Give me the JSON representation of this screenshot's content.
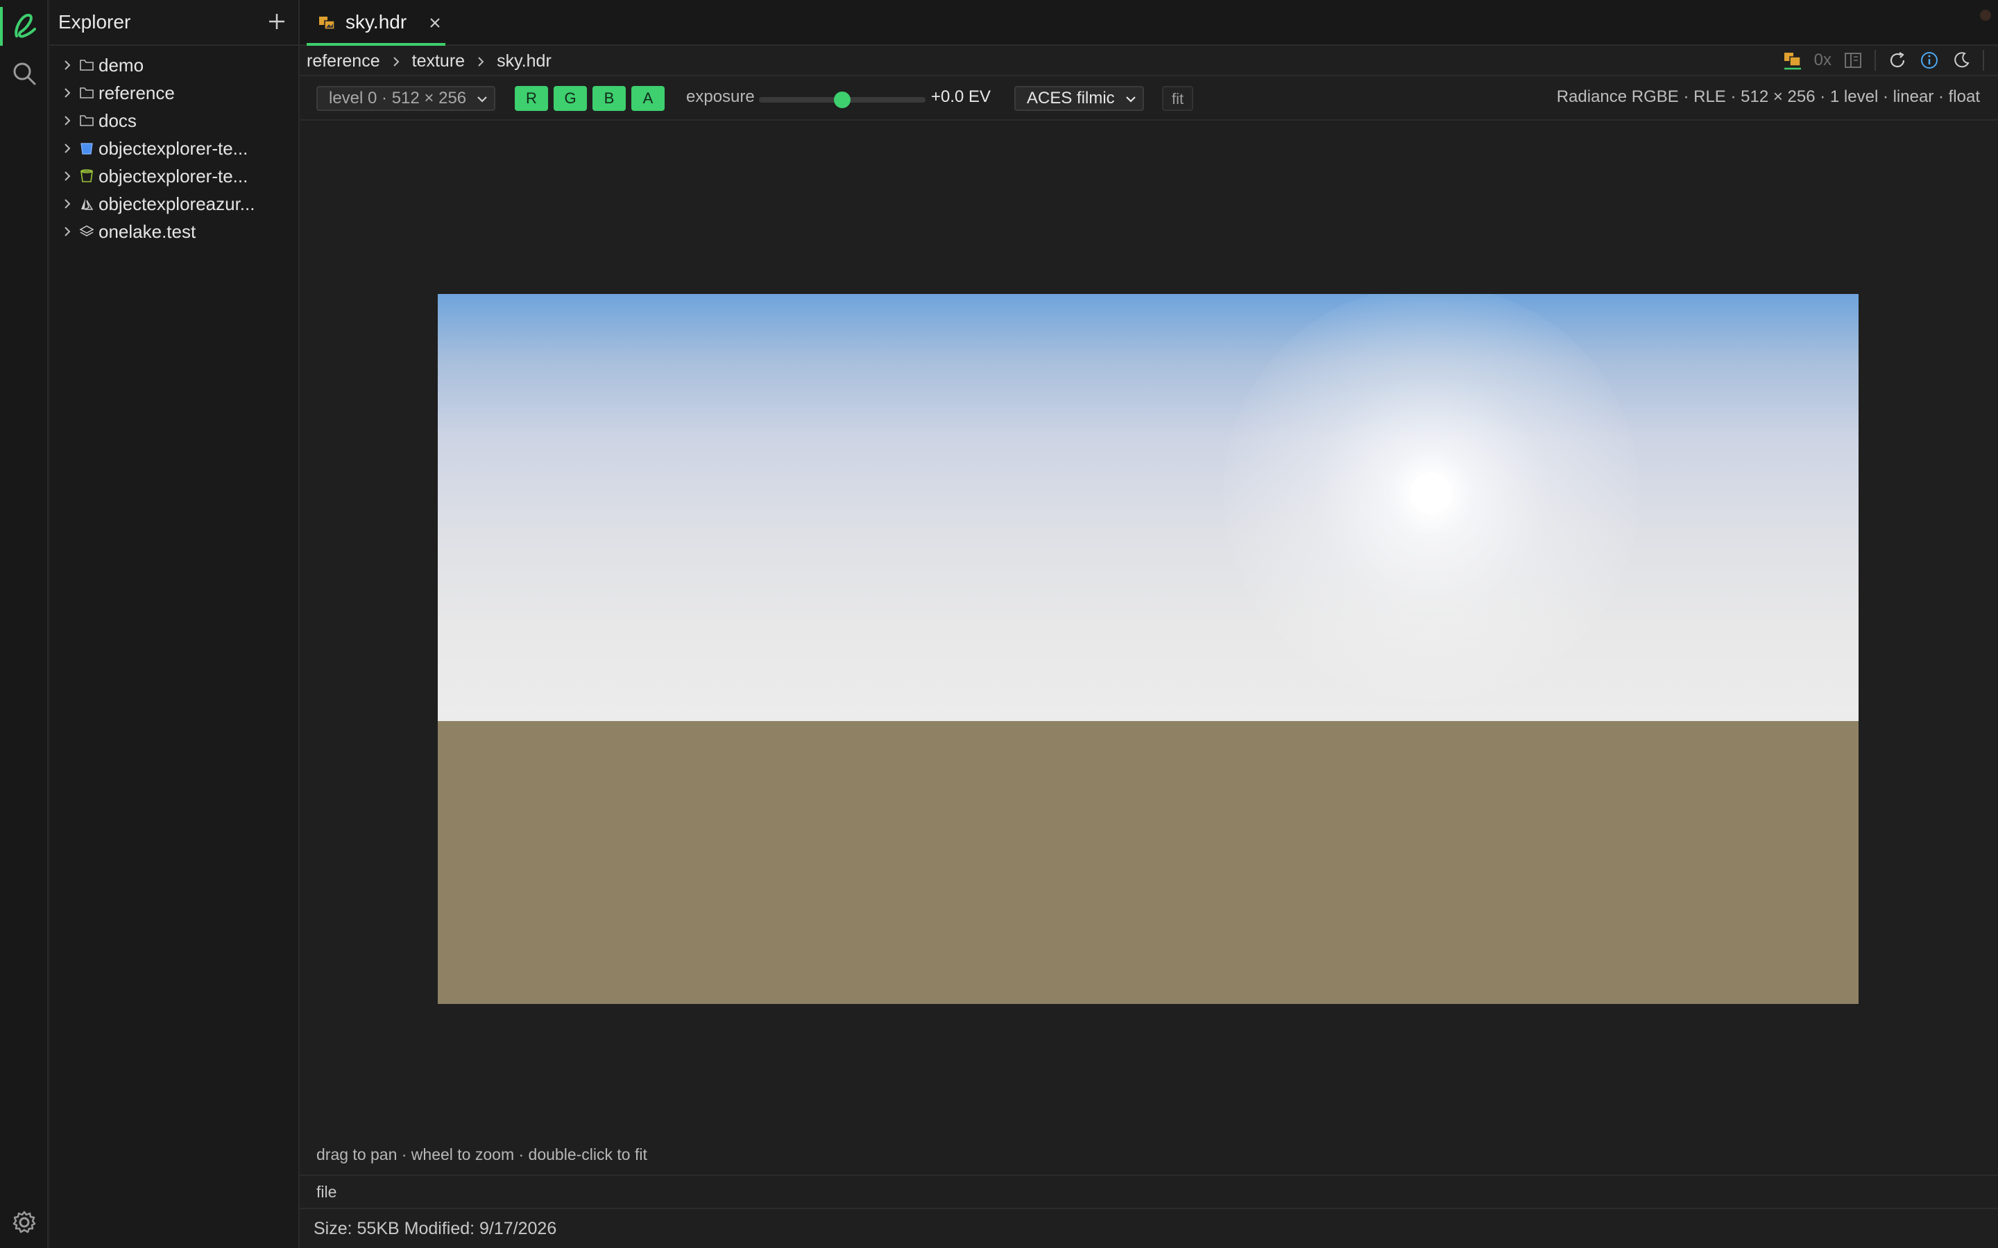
{
  "sidebar": {
    "title": "Explorer",
    "items": [
      {
        "label": "demo",
        "icon": "folder-icon"
      },
      {
        "label": "reference",
        "icon": "folder-icon"
      },
      {
        "label": "docs",
        "icon": "folder-icon"
      },
      {
        "label": "objectexplorer-te...",
        "icon": "bucket-icon"
      },
      {
        "label": "objectexplorer-te...",
        "icon": "bucket-outline-icon"
      },
      {
        "label": "objectexploreazur...",
        "icon": "azure-icon"
      },
      {
        "label": "onelake.test",
        "icon": "layers-icon"
      }
    ]
  },
  "tab": {
    "label": "sky.hdr"
  },
  "breadcrumb": [
    "reference",
    "texture",
    "sky.hdr"
  ],
  "topbar": {
    "zoom_text": "0x"
  },
  "toolbar": {
    "level_select": "level 0 · 512 × 256",
    "channels": [
      "R",
      "G",
      "B",
      "A"
    ],
    "exposure_label": "exposure",
    "exposure_value": "+0.0 EV",
    "exposure_fraction": 0.5,
    "tonemap_select": "ACES filmic",
    "fit_label": "fit",
    "file_info": "Radiance RGBE · RLE · 512 × 256 · 1 level · linear · float"
  },
  "viewer": {
    "hint": "drag to pan · wheel to zoom · double-click to fit"
  },
  "panel": {
    "tab_label": "file"
  },
  "status": {
    "text": "Size: 55KB Modified: 9/17/2026"
  },
  "colors": {
    "accent": "#3ecf6e",
    "sky_top": "#6fa4dc",
    "horizon": "#ececec",
    "ground": "#8f8264"
  }
}
